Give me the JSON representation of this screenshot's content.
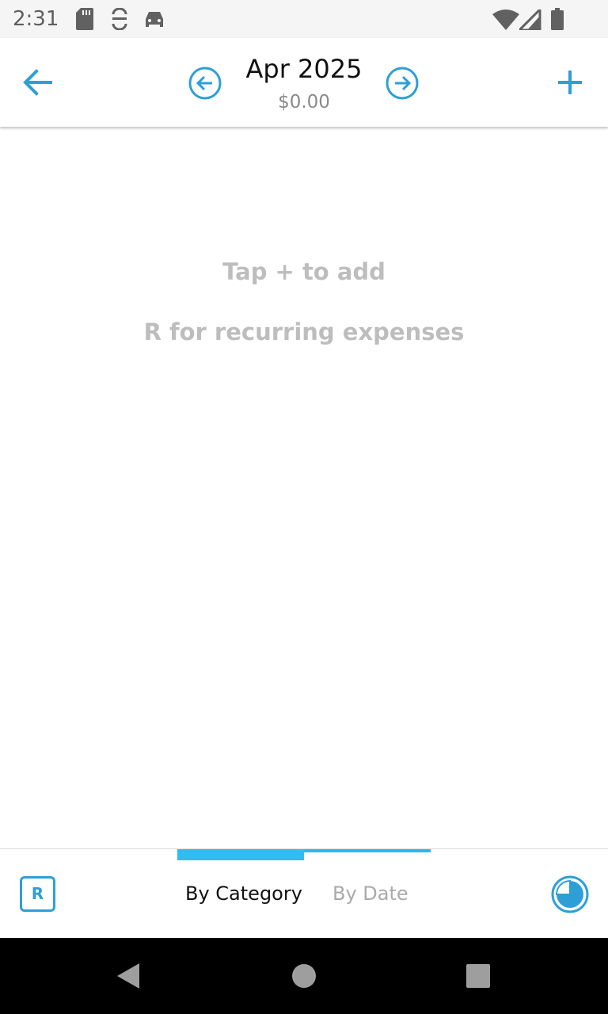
{
  "status_bar": {
    "time": "2:31",
    "icons": [
      "sd-card-icon",
      "sync-icon",
      "car-icon",
      "wifi-icon",
      "signal-icon",
      "battery-icon"
    ]
  },
  "app_bar": {
    "month": "Apr 2025",
    "total": "$0.00",
    "accent_color": "#2e9fd6"
  },
  "empty_state": {
    "line1": "Tap + to add",
    "line2": "R for recurring expenses"
  },
  "bottom_bar": {
    "recurring_label": "R",
    "tabs": [
      {
        "label": "By Category",
        "active": true
      },
      {
        "label": "By Date",
        "active": false
      }
    ]
  },
  "nav_bar": {
    "icons": [
      "back-triangle-icon",
      "home-circle-icon",
      "recents-square-icon"
    ]
  }
}
